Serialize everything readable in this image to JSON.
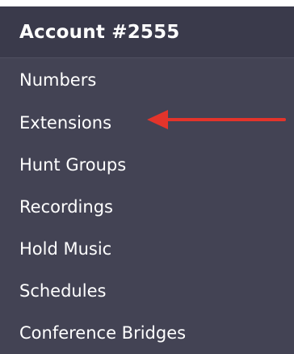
{
  "header": {
    "title": "Account #2555"
  },
  "menu": {
    "items": [
      {
        "label": "Numbers"
      },
      {
        "label": "Extensions"
      },
      {
        "label": "Hunt Groups"
      },
      {
        "label": "Recordings"
      },
      {
        "label": "Hold Music"
      },
      {
        "label": "Schedules"
      },
      {
        "label": "Conference Bridges"
      }
    ]
  },
  "annotation": {
    "icon": "arrow-left-icon",
    "color": "#e3342b"
  },
  "colors": {
    "panel_bg": "#434354",
    "header_bg": "#3a3a4b",
    "text": "#ffffff"
  }
}
